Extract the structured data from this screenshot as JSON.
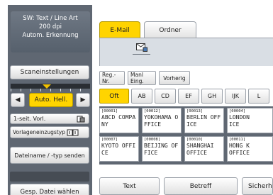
{
  "left_panel": {
    "status_lines": [
      "SW: Text / Line Art",
      "200 dpi",
      "Autom. Erkennung"
    ],
    "scan_settings_label": "Scaneinstellungen",
    "density_left_arrow": "◀",
    "density_label": "Auto. Hell.",
    "density_right_arrow": "▶",
    "onesided_label": "1-seit. Vorl.",
    "original_feed_label": "Vorlageneinzugstyp",
    "filename_label": "Dateiname / -typ senden",
    "stored_file_label": "Gesp. Datei wählen"
  },
  "tabs": {
    "email": "E-Mail",
    "folder": "Ordner"
  },
  "search": {
    "reg_no": "Reg.-Nr.",
    "manual": "Manl Eing.",
    "previous": "Vorherig"
  },
  "index_tabs": [
    "Oft",
    "AB",
    "CD",
    "EF",
    "GH",
    "IJK",
    "L"
  ],
  "destinations": [
    {
      "num": "[00001]",
      "name": "ABCD COMPA\nNY"
    },
    {
      "num": "[00012]",
      "name": "YOKOHAMA O\nFFICE"
    },
    {
      "num": "[00013]",
      "name": "BERLIN OFF\nICE"
    },
    {
      "num": "[00004]",
      "name": "LONDON\nICE"
    },
    {
      "num": "[00007]",
      "name": "KYOTO OFFI\nCE"
    },
    {
      "num": "[00008]",
      "name": "BEIJING OF\nFICE"
    },
    {
      "num": "[00010]",
      "name": "SHANGHAI\nOFFICE"
    },
    {
      "num": "[00011]",
      "name": "HONG K\nOFFICE"
    }
  ],
  "bottom": {
    "text": "Text",
    "subject": "Betreff",
    "security": "Sicherh"
  },
  "colors": {
    "accent": "#ffd400",
    "panel": "#5f6772"
  }
}
